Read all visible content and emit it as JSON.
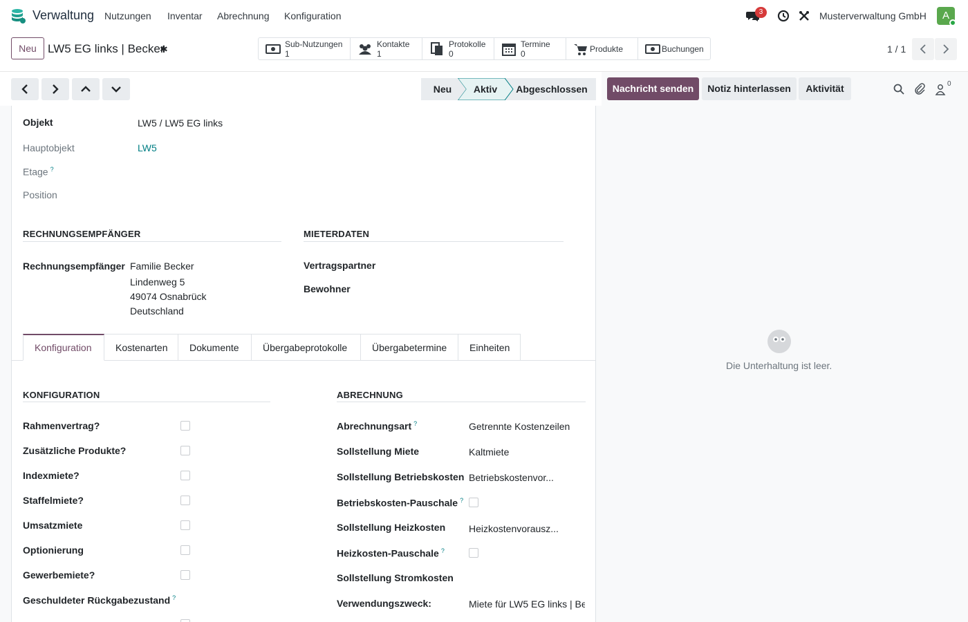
{
  "app": {
    "brand": "Verwaltung",
    "menu": [
      "Nutzungen",
      "Inventar",
      "Abrechnung",
      "Konfiguration"
    ],
    "message_count": "3",
    "company": "Musterverwaltung GmbH",
    "avatar_letter": "A",
    "accent_color": "#714b67",
    "teal_color": "#017e84"
  },
  "control": {
    "new_button": "Neu",
    "record_title": "LW5 EG links | Becker",
    "smart_buttons": [
      {
        "label": "Sub-Nutzungen",
        "value": "1",
        "icon": "money-icon"
      },
      {
        "label": "Kontakte",
        "value": "1",
        "icon": "users-icon"
      },
      {
        "label": "Protokolle",
        "value": "0",
        "icon": "files-icon"
      },
      {
        "label": "Termine",
        "value": "0",
        "icon": "calendar-icon"
      },
      {
        "label": "Produkte",
        "icon": "cart-icon"
      },
      {
        "label": "Buchungen",
        "icon": "money-icon"
      }
    ],
    "pager": "1 / 1"
  },
  "status": {
    "steps": [
      "Neu",
      "Aktiv",
      "Abgeschlossen"
    ],
    "current": "Aktiv"
  },
  "chatter_buttons": {
    "send": "Nachricht senden",
    "note": "Notiz hinterlassen",
    "activity": "Aktivität",
    "followers": "0"
  },
  "form": {
    "objekt_label": "Objekt",
    "objekt_value": "LW5 / LW5 EG links",
    "hauptobjekt_label": "Hauptobjekt",
    "hauptobjekt_value": "LW5",
    "etage_label": "Etage",
    "position_label": "Position",
    "section_rechnung": "RECHNUNGSEMPFÄNGER",
    "section_mieter": "MIETERDATEN",
    "rechnungsempfaenger_label": "Rechnungsempfänger",
    "address": [
      "Familie Becker",
      "Lindenweg 5",
      "49074 Osnabrück",
      "Deutschland"
    ],
    "vertragspartner_label": "Vertragspartner",
    "bewohner_label": "Bewohner",
    "help_mark": "?"
  },
  "tabs": [
    "Konfiguration",
    "Kostenarten",
    "Dokumente",
    "Übergabeprotokolle",
    "Übergabetermine",
    "Einheiten"
  ],
  "konfiguration": {
    "section": "KONFIGURATION",
    "fields": [
      "Rahmenvertrag?",
      "Zusätzliche Produkte?",
      "Indexmiete?",
      "Staffelmiete?",
      "Umsatzmiete",
      "Optionierung",
      "Gewerbemiete?",
      "Geschuldeter Rückgabezustand"
    ]
  },
  "abrechnung": {
    "section": "ABRECHNUNG",
    "fields": [
      {
        "label": "Abrechnungsart",
        "value": "Getrennte Kostenzeilen",
        "help": true
      },
      {
        "label": "Sollstellung Miete",
        "value": "Kaltmiete"
      },
      {
        "label": "Sollstellung Betriebskosten",
        "value": "Betriebskostenvor..."
      },
      {
        "label": "Betriebskosten-Pauschale",
        "checkbox": true,
        "help": true
      },
      {
        "label": "Sollstellung Heizkosten",
        "value": "Heizkostenvorausz..."
      },
      {
        "label": "Heizkosten-Pauschale",
        "checkbox": true,
        "help": true
      },
      {
        "label": "Sollstellung Stromkosten",
        "value": ""
      },
      {
        "label": "Verwendungszweck:",
        "value": "Miete für LW5 EG links | Be"
      }
    ]
  },
  "chatter": {
    "empty_text": "Die Unterhaltung ist leer."
  }
}
